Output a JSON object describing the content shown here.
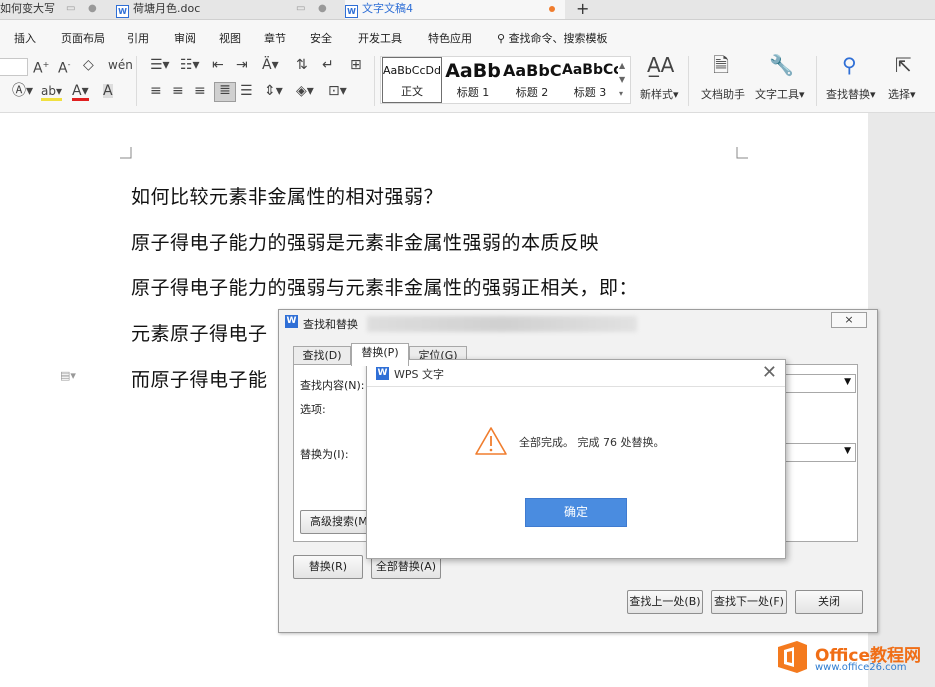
{
  "tabs": [
    {
      "label": "如何变大写"
    },
    {
      "label": "荷塘月色.doc"
    },
    {
      "label": "文字文稿4"
    }
  ],
  "new_tab_symbol": "+",
  "menu": [
    "插入",
    "页面布局",
    "引用",
    "审阅",
    "视图",
    "章节",
    "安全",
    "开发工具",
    "特色应用"
  ],
  "search_command": "查找命令、搜索模板",
  "styles": [
    {
      "preview": "AaBbCcDd",
      "label": "正文"
    },
    {
      "preview": "AaBb",
      "label": "标题 1"
    },
    {
      "preview": "AaBbC",
      "label": "标题 2"
    },
    {
      "preview": "AaBbCc",
      "label": "标题 3"
    }
  ],
  "ribbon_tools": {
    "new_style": "新样式",
    "doc_helper": "文档助手",
    "text_tools": "文字工具",
    "find_replace": "查找替换",
    "select": "选择"
  },
  "document": {
    "lines": [
      "如何比较元素非金属性的相对强弱？",
      "原子得电子能力的强弱是元素非金属性强弱的本质反映",
      "原子得电子能力的强弱与元素非金属性的强弱正相关，即：",
      "元素原子得电子",
      "而原子得电子能"
    ]
  },
  "find_replace": {
    "title": "查找和替换",
    "close_label": "×",
    "tabs": [
      "查找(D)",
      "替换(P)",
      "定位(G)"
    ],
    "find_label": "查找内容(N):",
    "options_label": "选项:",
    "replace_label": "替换为(I):",
    "advanced_button": "高级搜索(M)",
    "replace_button": "替换(R)",
    "replace_all_button": "全部替换(A)",
    "find_prev_button": "查找上一处(B)",
    "find_next_button": "查找下一处(F)",
    "close_button": "关闭"
  },
  "alert": {
    "title": "WPS 文字",
    "message": "全部完成。 完成 76 处替换。",
    "ok_button": "确定"
  },
  "watermark": {
    "name": "Office教程网",
    "url": "www.office26.com"
  },
  "colors": {
    "accent_blue": "#4a8ce0",
    "warning_orange": "#f07d2e",
    "wps_blue": "#2f6fd6"
  }
}
